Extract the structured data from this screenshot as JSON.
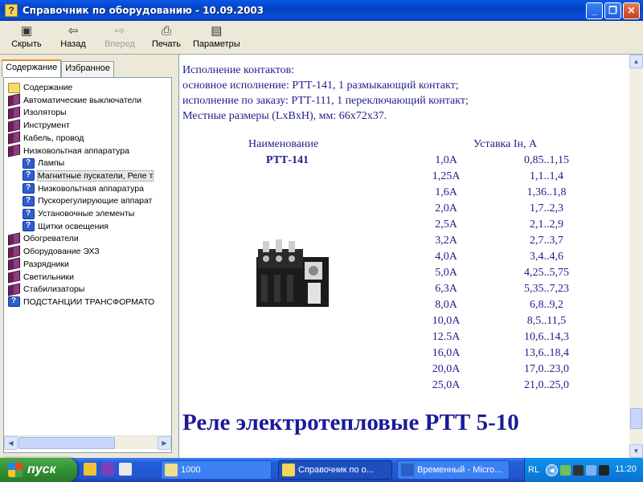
{
  "window": {
    "title": "Справочник по оборудованию - 10.09.2003"
  },
  "toolbar": {
    "hide": "Скрыть",
    "back": "Назад",
    "forward": "Вперед",
    "print": "Печать",
    "options": "Параметры"
  },
  "tabs": {
    "contents": "Содержание",
    "favorites": "Избранное"
  },
  "tree": [
    {
      "label": "Содержание",
      "icon": "folder-icon"
    },
    {
      "label": "Автоматические выключатели",
      "icon": "book-icon"
    },
    {
      "label": "Изоляторы",
      "icon": "book-icon"
    },
    {
      "label": "Инструмент",
      "icon": "book-icon"
    },
    {
      "label": "Кабель, провод",
      "icon": "book-icon"
    },
    {
      "label": "Низковольтная аппаратура",
      "icon": "open-book-icon"
    },
    {
      "label": "Лампы",
      "icon": "help-page-icon"
    },
    {
      "label": "Магнитные пускатели, Реле т",
      "icon": "help-page-icon"
    },
    {
      "label": "Низковольтная аппаратура",
      "icon": "help-page-icon"
    },
    {
      "label": "Пускорегулирующие аппарат",
      "icon": "help-page-icon"
    },
    {
      "label": "Установочные элементы",
      "icon": "help-page-icon"
    },
    {
      "label": "Щитки освещения",
      "icon": "help-page-icon"
    },
    {
      "label": "Обогреватели",
      "icon": "book-icon"
    },
    {
      "label": "Оборудование ЭХЗ",
      "icon": "book-icon"
    },
    {
      "label": "Разрядники",
      "icon": "book-icon"
    },
    {
      "label": "Светильники",
      "icon": "book-icon"
    },
    {
      "label": "Стабилизаторы",
      "icon": "book-icon"
    },
    {
      "label": "ПОДСТАНЦИИ  ТРАНСФОРМАТО",
      "icon": "help-page-icon"
    }
  ],
  "content": {
    "intro": [
      "Исполнение контактов:",
      "основное исполнение: РТТ-141, 1 размыкающий контакт;",
      "исполнение по заказу: РТТ-111, 1 переключающий контакт;",
      "Местные размеры (LxBxH), мм: 66х72х37."
    ],
    "col_name": "Наименование",
    "model": "РТТ-141",
    "col_setting": "Уставка Iн, А",
    "rows": [
      [
        "1,0А",
        "0,85..1,15"
      ],
      [
        "1,25А",
        "1,1..1,4"
      ],
      [
        "1,6А",
        "1,36..1,8"
      ],
      [
        "2,0А",
        "1,7..2,3"
      ],
      [
        "2,5А",
        "2,1..2,9"
      ],
      [
        "3,2А",
        "2,7..3,7"
      ],
      [
        "4,0А",
        "3,4..4,6"
      ],
      [
        "5,0А",
        "4,25..5,75"
      ],
      [
        "6,3А",
        "5,35..7,23"
      ],
      [
        "8,0А",
        "6,8..9,2"
      ],
      [
        "10,0А",
        "8,5..11,5"
      ],
      [
        "12.5А",
        "10,6..14,3"
      ],
      [
        "16,0А",
        "13,6..18,4"
      ],
      [
        "20,0А",
        "17,0..23,0"
      ],
      [
        "25,0А",
        "21,0..25,0"
      ]
    ],
    "heading": "Реле электротепловые РТТ 5-10"
  },
  "taskbar": {
    "start": "пуск",
    "tasks": [
      {
        "label": "1000"
      },
      {
        "label": "Справочник по о..."
      },
      {
        "label": "Временный - Micro..."
      }
    ],
    "lang": "RL",
    "clock": "11:20"
  }
}
